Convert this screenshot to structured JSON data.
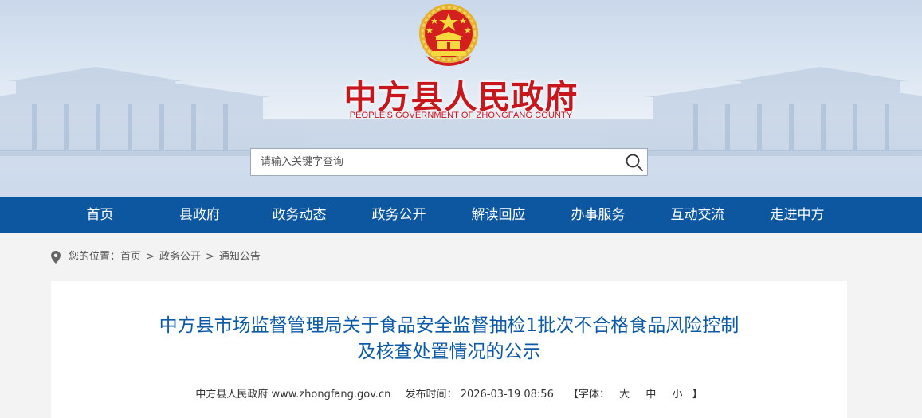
{
  "header": {
    "site_title": "中方县人民政府",
    "site_subtitle": "PEOPLE'S GOVERNMENT OF ZHONGFANG COUNTY",
    "emblem_icon": "national-emblem-icon",
    "title_color": "#c8161d"
  },
  "search": {
    "placeholder": "请输入关键字查询",
    "value": "",
    "icon": "search-icon"
  },
  "nav": {
    "background": "#0d57a1",
    "items": [
      "首页",
      "县政府",
      "政务动态",
      "政务公开",
      "解读回应",
      "办事服务",
      "互动交流",
      "走进中方"
    ]
  },
  "breadcrumb": {
    "icon": "location-pin-icon",
    "label": "您的位置：",
    "items": [
      "首页",
      "政务公开",
      "通知公告"
    ],
    "separator": ">"
  },
  "article": {
    "title_line1": "中方县市场监督管理局关于食品安全监督抽检1批次不合格食品风险控制",
    "title_line2": "及核查处置情况的公示",
    "title_color": "#0c5aa7",
    "source": "中方县人民政府 www.zhongfang.gov.cn",
    "publish_label": "发布时间：",
    "publish_time": "2026-03-19 08:56",
    "font_label": "【字体：",
    "font_sizes": [
      "大",
      "中",
      "小"
    ],
    "font_close": "】"
  }
}
